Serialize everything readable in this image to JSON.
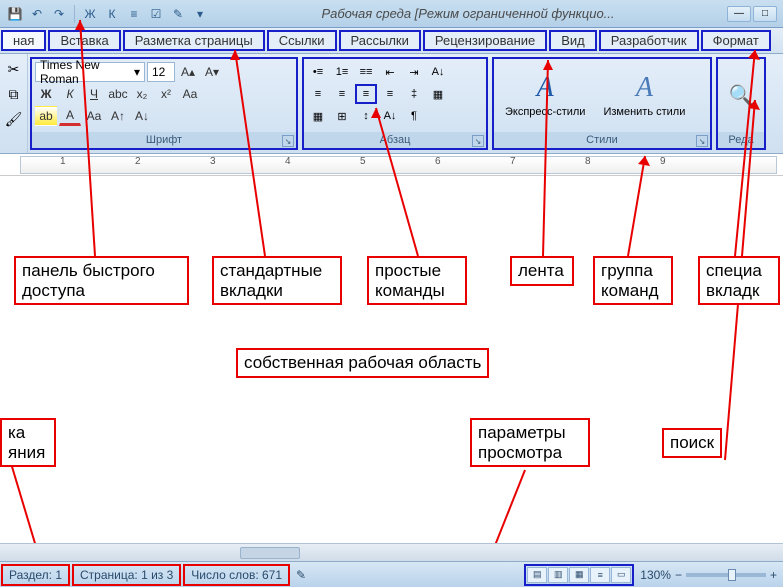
{
  "title": "Рабочая среда [Режим ограниченной функцио...",
  "qat_icons": [
    "save",
    "undo",
    "redo",
    "bold",
    "italic",
    "list",
    "check",
    "spelling",
    "dropdown"
  ],
  "tabs": [
    {
      "label": "ная"
    },
    {
      "label": "Вставка"
    },
    {
      "label": "Разметка страницы"
    },
    {
      "label": "Ссылки"
    },
    {
      "label": "Рассылки"
    },
    {
      "label": "Рецензирование"
    },
    {
      "label": "Вид"
    },
    {
      "label": "Разработчик"
    },
    {
      "label": "Формат"
    }
  ],
  "ribbon": {
    "font": {
      "label": "Шрифт",
      "name": "Times New Roman",
      "size": "12",
      "row2": [
        "Ж",
        "К",
        "Ч",
        "abc",
        "x₂",
        "x²",
        "Aa"
      ],
      "row3": [
        "ab",
        "A",
        "Aa",
        "A↑",
        "A↓"
      ]
    },
    "paragraph": {
      "label": "Абзац",
      "row1": [
        "≔",
        "≔",
        "≔",
        "≡",
        "≡",
        "≡"
      ],
      "row2": [
        "≡",
        "≡",
        "≡",
        "≡",
        "‡",
        "≡"
      ],
      "row3": [
        "▦",
        "⊞",
        "↕",
        "A↓",
        "¶"
      ]
    },
    "styles": {
      "label": "Стили",
      "express": "Экспресс-стили",
      "change": "Изменить стили"
    },
    "edit": "Реда"
  },
  "ruler_ticks": [
    "1",
    "2",
    "3",
    "4",
    "5",
    "6",
    "7",
    "8",
    "9"
  ],
  "annotations": {
    "qat": "панель быстрого доступа",
    "std_tabs": "стандартные вкладки",
    "simple_cmds": "простые команды",
    "ribbon": "лента",
    "group": "группа команд",
    "special": "специа\nвкладк",
    "workarea": "собственная рабочая область",
    "left_partial": "ка\nяния",
    "view_params": "параметры просмотра",
    "search": "поиск"
  },
  "status": {
    "section": "Раздел: 1",
    "page": "Страница: 1 из 3",
    "words": "Число слов: 671",
    "zoom": "130%"
  }
}
